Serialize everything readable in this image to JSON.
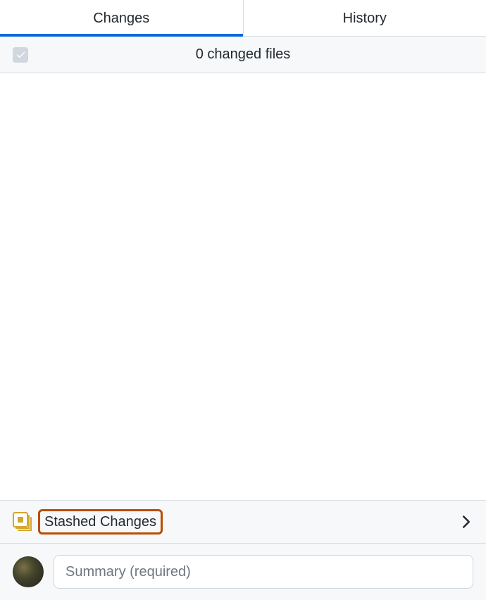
{
  "tabs": {
    "changes": "Changes",
    "history": "History"
  },
  "filesBar": {
    "label": "0 changed files"
  },
  "stashed": {
    "label": "Stashed Changes"
  },
  "commit": {
    "summaryPlaceholder": "Summary (required)"
  }
}
